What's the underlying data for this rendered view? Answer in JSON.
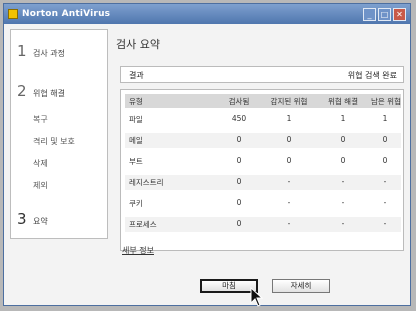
{
  "window": {
    "title": "Norton AntiVirus",
    "minimize": "_",
    "maximize": "□",
    "close": "✕"
  },
  "sidebar": {
    "steps": [
      {
        "num": "1",
        "label": "검사 과정"
      },
      {
        "num": "2",
        "label": "위협 해결",
        "sub": [
          "복구",
          "격리 및 보호",
          "삭제",
          "제외"
        ]
      },
      {
        "num": "3",
        "label": "요약"
      }
    ]
  },
  "main": {
    "title": "검사 요약",
    "info_left": "결과",
    "info_right": "위협 검색 완료",
    "table": {
      "headers": [
        "유형",
        "검사됨",
        "감지된 위협",
        "위협 해결",
        "남은 위협"
      ],
      "rows": [
        [
          "파일",
          "450",
          "1",
          "1",
          "1"
        ],
        [
          "메일",
          "0",
          "0",
          "0",
          "0"
        ],
        [
          "부트",
          "0",
          "0",
          "0",
          "0"
        ],
        [
          "레지스트리",
          "0",
          "-",
          "-",
          "-"
        ],
        [
          "쿠키",
          "0",
          "-",
          "-",
          "-"
        ],
        [
          "프로세스",
          "0",
          "-",
          "-",
          "-"
        ]
      ]
    },
    "details_link": "세부 정보",
    "buttons": {
      "finish": "마침",
      "more": "자세히"
    }
  }
}
